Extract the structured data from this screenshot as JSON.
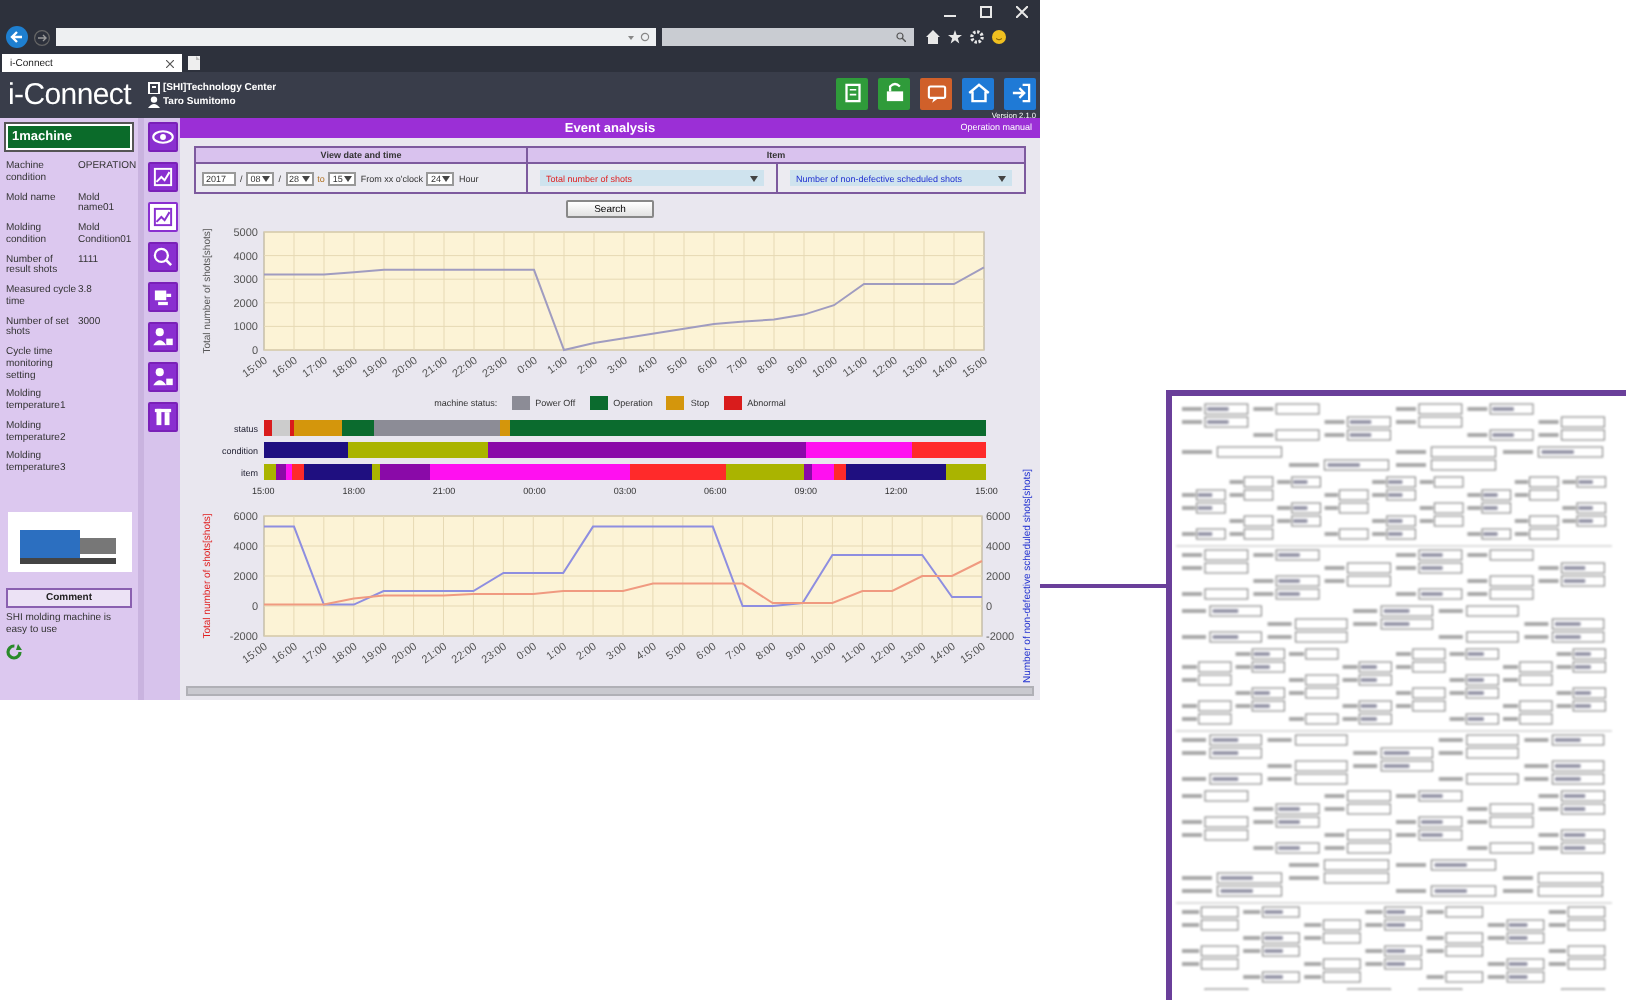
{
  "browser": {
    "tab_title": "i-Connect"
  },
  "header": {
    "logo": "i-Connect",
    "site": "[SHI]Technology Center",
    "user": "Taro Sumitomo",
    "version": "Version 2.1.0"
  },
  "machine": {
    "name": "1machine",
    "fields": [
      {
        "label": "Machine condition",
        "value": "OPERATION"
      },
      {
        "label": "Mold name",
        "value": "Mold name01"
      },
      {
        "label": "Molding condition",
        "value": "Mold Condition01"
      },
      {
        "label": "Number of result shots",
        "value": "1111"
      },
      {
        "label": "Measured cycle time",
        "value": "3.8"
      },
      {
        "label": "Number of set shots",
        "value": "3000"
      },
      {
        "label": "Cycle time monitoring setting"
      },
      {
        "label": "Molding temperature1"
      },
      {
        "label": "Molding temperature2"
      },
      {
        "label": "Molding temperature3"
      }
    ],
    "comment_title": "Comment",
    "comment": "SHI molding machine is easy to use"
  },
  "nav": [
    {
      "kind": "eye",
      "selected": false
    },
    {
      "kind": "chart",
      "selected": false
    },
    {
      "kind": "chart",
      "selected": true
    },
    {
      "kind": "search",
      "selected": false
    },
    {
      "kind": "machine",
      "selected": false
    },
    {
      "kind": "person",
      "selected": false
    },
    {
      "kind": "person",
      "selected": false
    },
    {
      "kind": "tools",
      "selected": false
    }
  ],
  "page": {
    "title": "Event analysis",
    "manual": "Operation manual"
  },
  "filter": {
    "date_header": "View date and time",
    "item_header": "Item",
    "year": "2017",
    "sep_1": "/",
    "month": "08",
    "sep_2": "/",
    "day": "28",
    "to": "to",
    "hour": "15",
    "from_label": "From xx o'clock",
    "span": "24",
    "span_unit": "Hour",
    "item_1": "Total number of shots",
    "item_2": "Number of non-defective scheduled shots",
    "search": "Search"
  },
  "chart_1": {
    "chart_data": {
      "type": "line",
      "ylabel": "Total number of shots[shots]",
      "categories": [
        "15:00",
        "16:00",
        "17:00",
        "18:00",
        "19:00",
        "20:00",
        "21:00",
        "22:00",
        "23:00",
        "0:00",
        "1:00",
        "2:00",
        "3:00",
        "4:00",
        "5:00",
        "6:00",
        "7:00",
        "8:00",
        "9:00",
        "10:00",
        "11:00",
        "12:00",
        "13:00",
        "14:00",
        "15:00"
      ],
      "values": [
        3200,
        3200,
        3200,
        3300,
        3400,
        3400,
        3400,
        3400,
        3400,
        3400,
        0,
        300,
        500,
        700,
        900,
        1100,
        1200,
        1300,
        1500,
        1900,
        2800,
        2800,
        2800,
        2800,
        3500
      ],
      "ylim": [
        0,
        5000
      ],
      "yticks": [
        0,
        1000,
        2000,
        3000,
        4000,
        5000
      ],
      "grid": true
    }
  },
  "legend": {
    "title": "machine status:",
    "items": [
      {
        "label": "Power Off",
        "color": "#8c8c96"
      },
      {
        "label": "Operation",
        "color": "#0b6b2e"
      },
      {
        "label": "Stop",
        "color": "#d4960c"
      },
      {
        "label": "Abnormal",
        "color": "#d91c1c"
      }
    ]
  },
  "timeline": {
    "rows": [
      {
        "label": "status"
      },
      {
        "label": "condition"
      },
      {
        "label": "item"
      }
    ],
    "ticks": [
      "15:00",
      "18:00",
      "21:00",
      "00:00",
      "03:00",
      "06:00",
      "09:00",
      "12:00",
      "15:00"
    ]
  },
  "chart_2": {
    "chart_data": {
      "type": "line",
      "ylabel": "Total number of shots[shots]",
      "categories": [
        "15:00",
        "16:00",
        "17:00",
        "18:00",
        "19:00",
        "20:00",
        "21:00",
        "22:00",
        "23:00",
        "0:00",
        "1:00",
        "2:00",
        "3:00",
        "4:00",
        "5:00",
        "6:00",
        "7:00",
        "8:00",
        "9:00",
        "10:00",
        "11:00",
        "12:00",
        "13:00",
        "14:00",
        "15:00"
      ],
      "series": [
        {
          "color": "#8e8ee0",
          "values": [
            5300,
            5300,
            100,
            100,
            1000,
            1000,
            1000,
            1000,
            2200,
            2200,
            2200,
            5300,
            5300,
            5300,
            5300,
            5300,
            0,
            0,
            200,
            3400,
            3400,
            3400,
            3400,
            600,
            600
          ]
        },
        {
          "color": "#f09a80",
          "values": [
            100,
            100,
            100,
            500,
            700,
            700,
            700,
            800,
            800,
            800,
            1000,
            1000,
            1000,
            1500,
            1500,
            1500,
            1500,
            200,
            200,
            200,
            1000,
            1000,
            2000,
            2000,
            3000
          ]
        }
      ],
      "ylim": [
        -2000,
        6000
      ],
      "yticks": [
        -2000,
        0,
        2000,
        4000,
        6000
      ],
      "grid": true
    },
    "right_yticks": [
      "6000",
      "4000",
      "2000",
      "0",
      "-2000"
    ],
    "right_axis_label": "Number of non-defective scheduled shots[shots]"
  }
}
